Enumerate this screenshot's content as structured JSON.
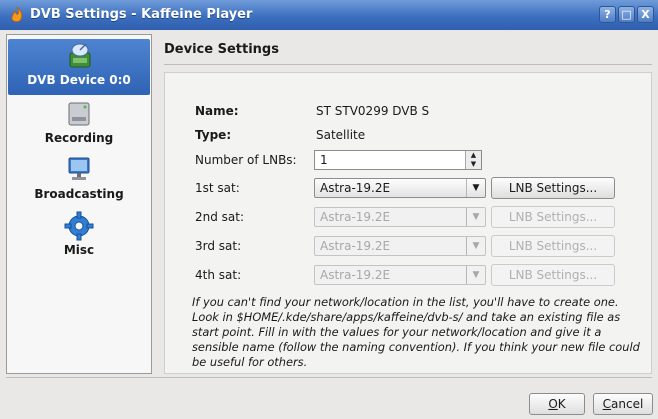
{
  "window": {
    "title": "DVB Settings - Kaffeine Player",
    "controls": {
      "help": "?",
      "maximize": "□",
      "close": "X"
    }
  },
  "sidebar": {
    "items": [
      {
        "label": "DVB Device 0:0",
        "icon": "satellite-dish-icon",
        "active": true
      },
      {
        "label": "Recording",
        "icon": "hard-drive-icon",
        "active": false
      },
      {
        "label": "Broadcasting",
        "icon": "monitor-network-icon",
        "active": false
      },
      {
        "label": "Misc",
        "icon": "gear-icon",
        "active": false
      }
    ]
  },
  "section": {
    "title": "Device Settings"
  },
  "device": {
    "name_label": "Name:",
    "name_value": "ST STV0299 DVB S",
    "type_label": "Type:",
    "type_value": "Satellite",
    "lnb_count_label": "Number of LNBs:",
    "lnb_count_value": "1"
  },
  "sats": [
    {
      "label": "1st sat:",
      "value": "Astra-19.2E",
      "button": "LNB Settings...",
      "enabled": true
    },
    {
      "label": "2nd sat:",
      "value": "Astra-19.2E",
      "button": "LNB Settings...",
      "enabled": false
    },
    {
      "label": "3rd sat:",
      "value": "Astra-19.2E",
      "button": "LNB Settings...",
      "enabled": false
    },
    {
      "label": "4th sat:",
      "value": "Astra-19.2E",
      "button": "LNB Settings...",
      "enabled": false
    }
  ],
  "help_text": "If you can't find your network/location in the list, you'll have to create one. Look in $HOME/.kde/share/apps/kaffeine/dvb-s/ and take an existing file as start point. Fill in with the values for your network/location and give it a sensible name (follow the naming convention). If you think your new file could be useful for others.",
  "buttons": {
    "ok_mnemonic": "O",
    "ok_rest": "K",
    "cancel_mnemonic": "C",
    "cancel_rest": "ancel"
  },
  "colors": {
    "title_bar": "#3d6fbf",
    "sidebar_selected": "#2e63b5"
  }
}
